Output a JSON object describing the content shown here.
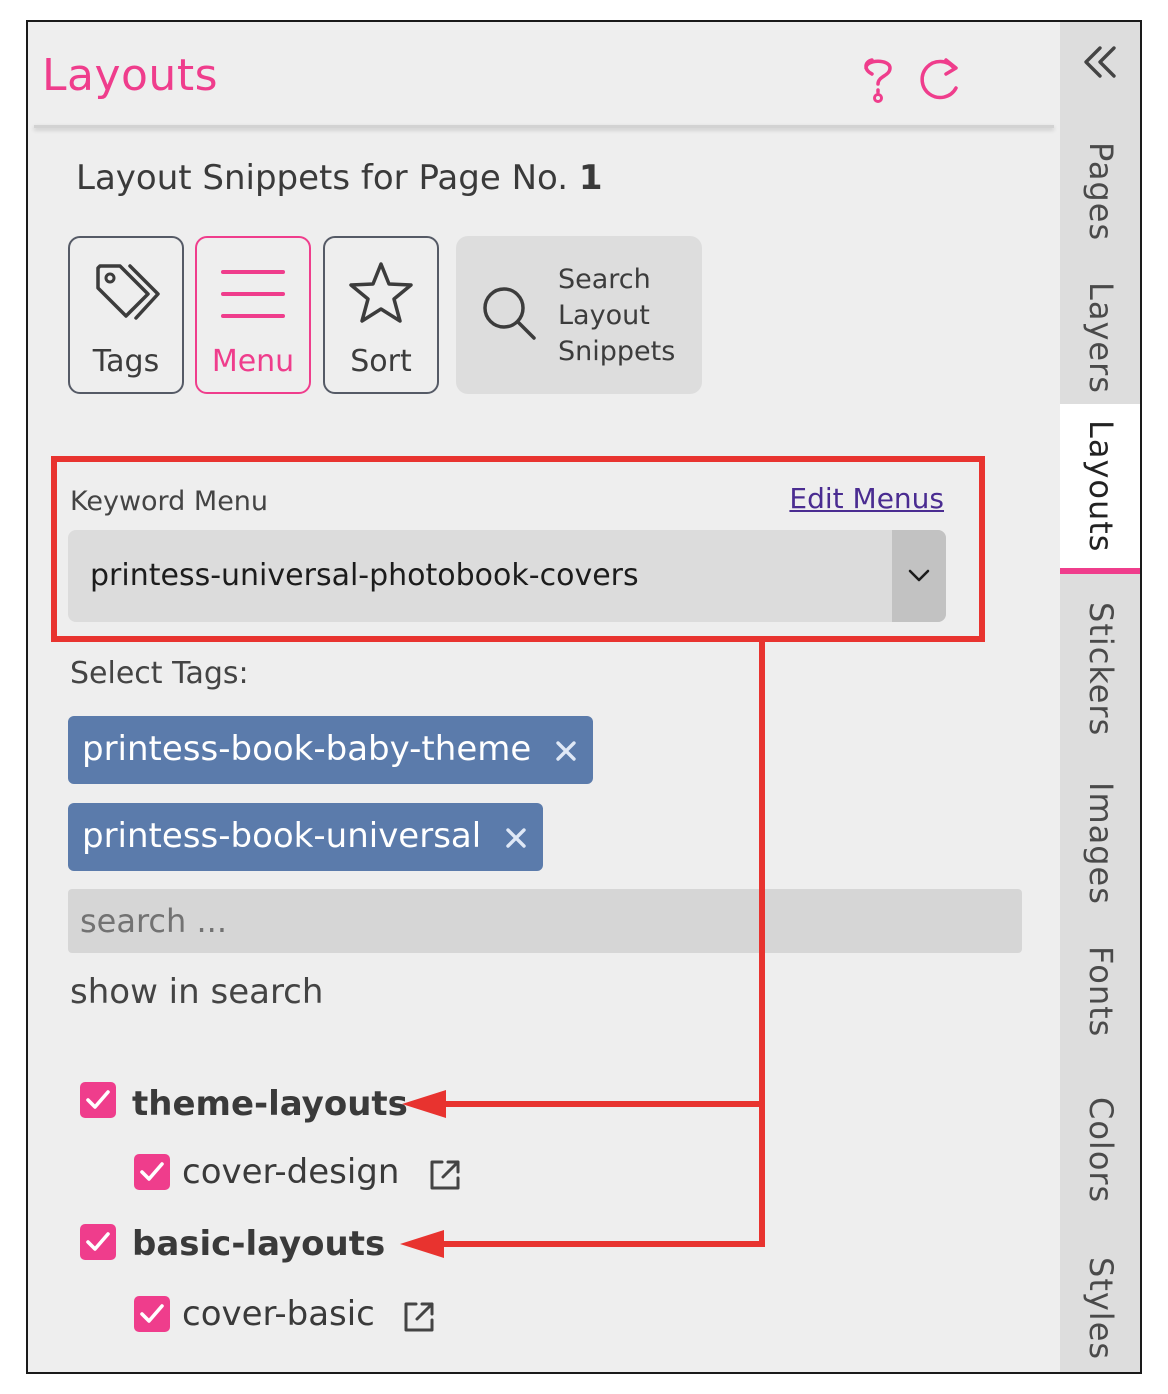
{
  "header": {
    "title": "Layouts",
    "help_icon": "question-icon",
    "refresh_icon": "refresh-icon"
  },
  "page_heading": {
    "label": "Layout Snippets for Page No.",
    "number": "1"
  },
  "toolbar": {
    "tags_label": "Tags",
    "menu_label": "Menu",
    "sort_label": "Sort",
    "search_line1": "Search",
    "search_line2": "Layout",
    "search_line3": "Snippets"
  },
  "keyword_menu": {
    "label": "Keyword Menu",
    "edit_link": "Edit Menus",
    "selected": "printess-universal-photobook-covers"
  },
  "tags": {
    "label": "Select Tags:",
    "selected": [
      "printess-book-baby-theme",
      "printess-book-universal"
    ],
    "search_placeholder": "search ...",
    "show_in_search": "show in search"
  },
  "tree": [
    {
      "label": "theme-layouts",
      "checked": true,
      "level": 0
    },
    {
      "label": "cover-design",
      "checked": true,
      "level": 1
    },
    {
      "label": "basic-layouts",
      "checked": true,
      "level": 0
    },
    {
      "label": "cover-basic",
      "checked": true,
      "level": 1
    }
  ],
  "side_tabs": [
    "Pages",
    "Layers",
    "Layouts",
    "Stickers",
    "Images",
    "Fonts",
    "Colors",
    "Styles"
  ],
  "active_tab": "Layouts",
  "colors": {
    "accent": "#ef3d8c",
    "tag_bg": "#5b7bab",
    "annotation_red": "#e8332f",
    "link": "#4a2c91"
  }
}
